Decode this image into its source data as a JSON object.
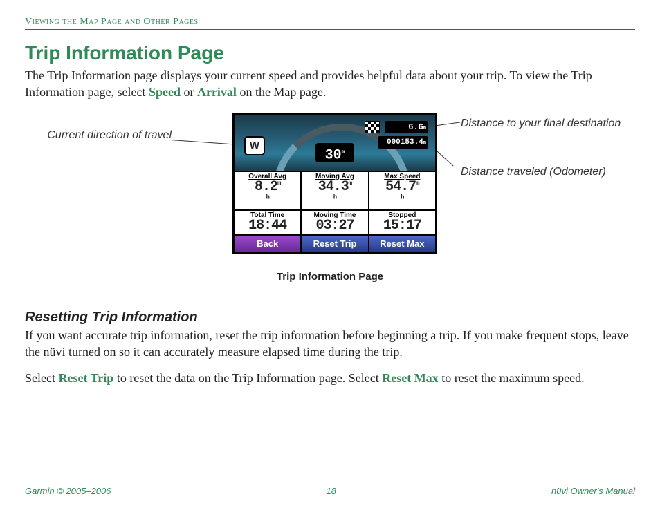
{
  "header": "Viewing the Map Page and Other Pages",
  "title": "Trip Information Page",
  "intro": {
    "part1": "The Trip Information page displays your current speed and provides helpful data about your trip. To view the Trip Information page, select ",
    "speed": "Speed",
    "or": " or ",
    "arrival": "Arrival",
    "part2": " on the Map page."
  },
  "callouts": {
    "left": "Current direction of travel",
    "right1": "Distance to your final destination",
    "right2": "Distance traveled (Odometer)"
  },
  "device": {
    "direction": "W",
    "speed": "30",
    "distance": "6.6",
    "odometer": "000153.4",
    "cells": [
      {
        "label": "Overall Avg",
        "value": "8.2",
        "unit": "m h"
      },
      {
        "label": "Moving Avg",
        "value": "34.3",
        "unit": "m h"
      },
      {
        "label": "Max Speed",
        "value": "54.7",
        "unit": "m h"
      },
      {
        "label": "Total Time",
        "value": "18:44",
        "unit": ""
      },
      {
        "label": "Moving Time",
        "value": "03:27",
        "unit": ""
      },
      {
        "label": "Stopped",
        "value": "15:17",
        "unit": ""
      }
    ],
    "buttons": {
      "back": "Back",
      "resetTrip": "Reset Trip",
      "resetMax": "Reset Max"
    }
  },
  "caption": "Trip Information Page",
  "section2": {
    "heading": "Resetting Trip Information",
    "p1": "If you want accurate trip information, reset the trip information before beginning a trip. If you make frequent stops, leave the nüvi turned on so it can accurately measure elapsed time during the trip.",
    "p2a": "Select ",
    "resetTrip": "Reset Trip",
    "p2b": " to reset the data on the Trip Information page. Select ",
    "resetMax": "Reset Max",
    "p2c": " to reset the maximum speed."
  },
  "footer": {
    "left": "Garmin © 2005–2006",
    "center": "18",
    "right": "nüvi Owner's Manual"
  }
}
